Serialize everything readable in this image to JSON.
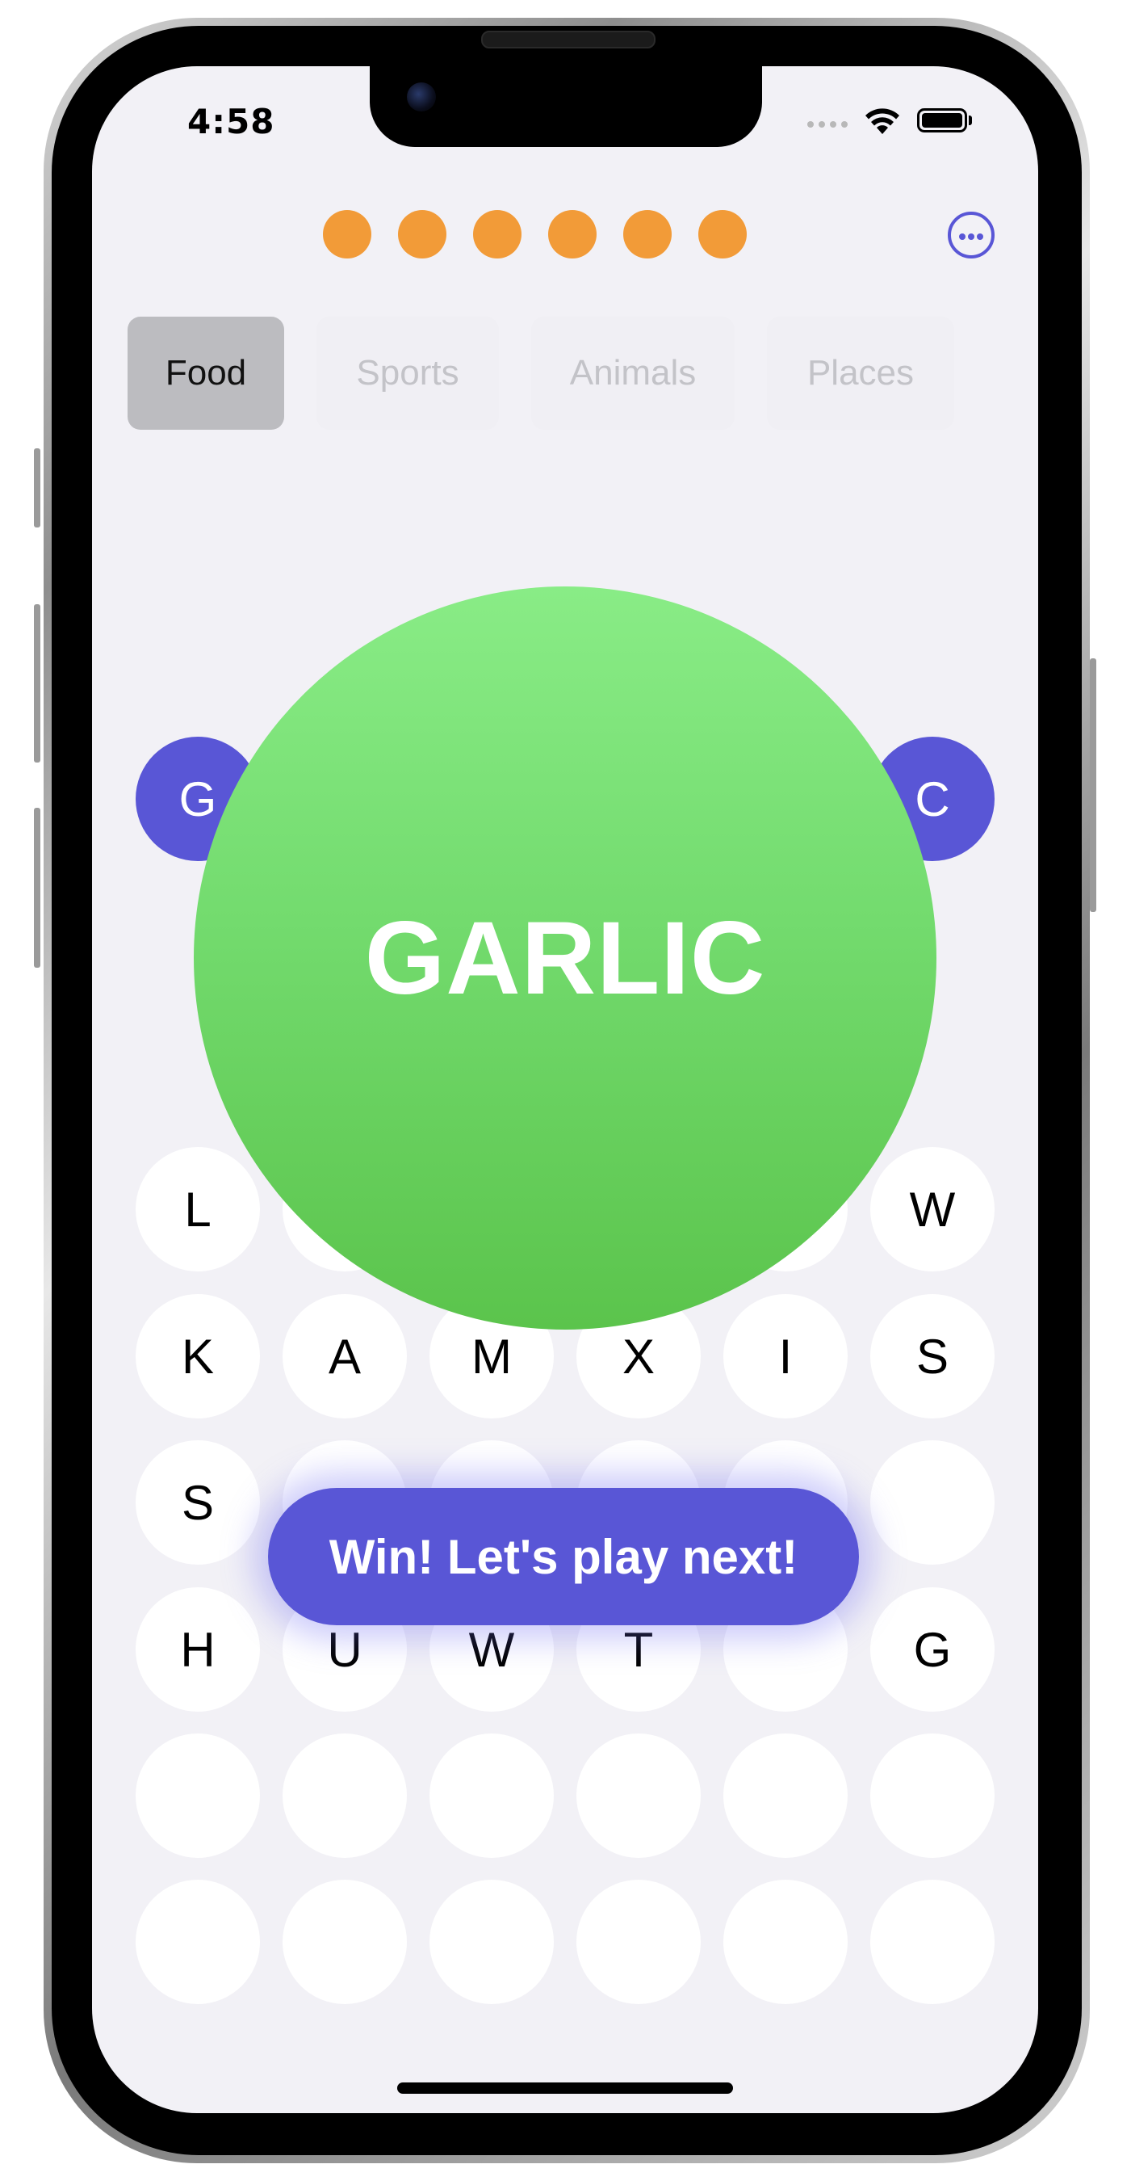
{
  "status_bar": {
    "time": "4:58"
  },
  "progress": {
    "lives_total": 6,
    "lives_remaining": 6,
    "dot_color": "#f29b38"
  },
  "menu": {
    "icon": "ellipsis-circle-icon"
  },
  "categories": [
    {
      "label": "Food",
      "selected": true
    },
    {
      "label": "Sports",
      "selected": false
    },
    {
      "label": "Animals",
      "selected": false
    },
    {
      "label": "Places",
      "selected": false
    }
  ],
  "guessed_letters": {
    "left": "G",
    "right": "C"
  },
  "result": {
    "word": "GARLIC",
    "color": "#6fd669"
  },
  "grid": {
    "rows": [
      [
        "L",
        "",
        "",
        "",
        "",
        "W"
      ],
      [
        "K",
        "A",
        "M",
        "X",
        "I",
        "S"
      ],
      [
        "S",
        "",
        "",
        "",
        "",
        ""
      ],
      [
        "H",
        "U",
        "W",
        "T",
        "",
        "G"
      ],
      [
        "",
        "",
        "",
        "",
        "",
        ""
      ],
      [
        "",
        "",
        "",
        "",
        "",
        ""
      ]
    ]
  },
  "win_button": {
    "label": "Win! Let's play next!",
    "color": "#5956d6"
  }
}
